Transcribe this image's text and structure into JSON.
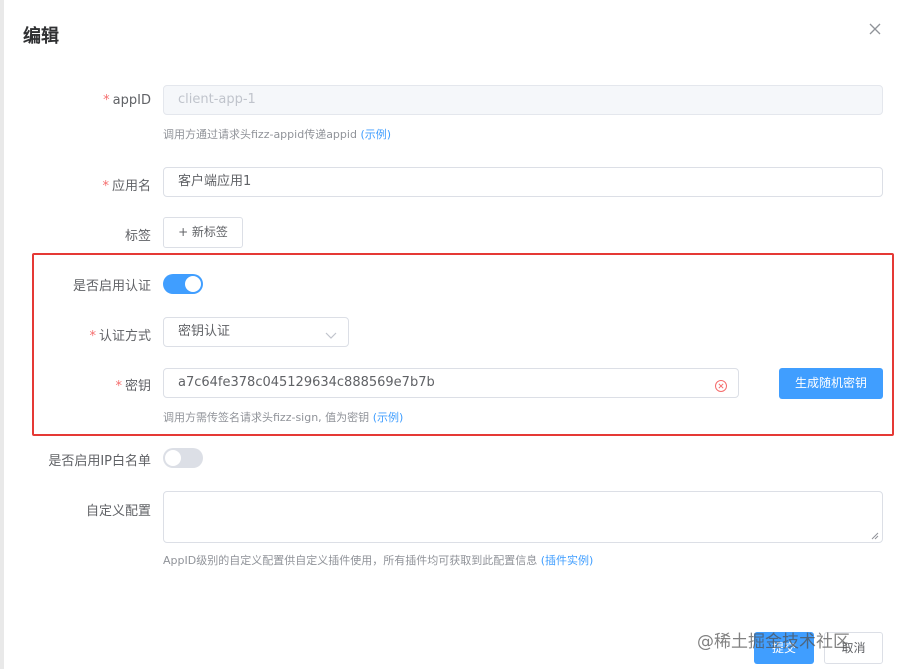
{
  "dialog": {
    "title": "编辑"
  },
  "form": {
    "appid": {
      "label": "appID",
      "value": "client-app-1",
      "hint": "调用方通过请求头fizz-appid传递appid",
      "hint_link": "(示例)"
    },
    "app_name": {
      "label": "应用名",
      "value": "客户端应用1"
    },
    "tags": {
      "label": "标签",
      "new_tag": "+ 新标签"
    },
    "auth_enabled": {
      "label": "是否启用认证",
      "on": true
    },
    "auth_method": {
      "label": "认证方式",
      "value": "密钥认证"
    },
    "secret": {
      "label": "密钥",
      "value": "a7c64fe378c045129634c888569e7b7b",
      "hint": "调用方需传签名请求头fizz-sign, 值为密钥",
      "hint_link": "(示例)",
      "generate_button": "生成随机密钥"
    },
    "ip_whitelist": {
      "label": "是否启用IP白名单",
      "on": false
    },
    "custom_config": {
      "label": "自定义配置",
      "value": "",
      "hint": "AppID级别的自定义配置供自定义插件使用，所有插件均可获取到此配置信息",
      "hint_link": "(插件实例)"
    }
  },
  "footer": {
    "submit": "提交",
    "cancel": "取消"
  },
  "watermark": "@稀土掘金技术社区",
  "colors": {
    "primary": "#409eff",
    "required": "#f56c6c",
    "highlight": "#e53935"
  }
}
